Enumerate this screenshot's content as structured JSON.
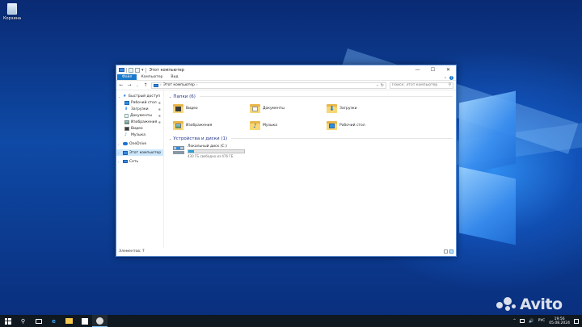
{
  "desktop": {
    "recycle_bin_label": "Корзина",
    "watermark": "Avito"
  },
  "window": {
    "title": "Этот компьютер",
    "quick_access_dropdown": "▾",
    "buttons": {
      "minimize": "—",
      "maximize": "☐",
      "close": "✕"
    },
    "ribbon_tabs": [
      "Файл",
      "Компьютер",
      "Вид"
    ],
    "ribbon_expand": "⌄",
    "help": "?",
    "address": {
      "path": "Этот компьютер",
      "separator": "›",
      "dropdown": "⌄",
      "refresh": "↻"
    },
    "search": {
      "placeholder": "Поиск: Этот компьютер",
      "icon": "⚲"
    },
    "nav": {
      "quick_access": "Быстрый доступ",
      "quick_items": [
        "Рабочий стол",
        "Загрузки",
        "Документы",
        "Изображения",
        "Видео",
        "Музыка"
      ],
      "pin": "✱",
      "onedrive": "OneDrive",
      "this_pc": "Этот компьютер",
      "network": "Сеть"
    },
    "folders_header": "Папки (6)",
    "folders": [
      "Видео",
      "Документы",
      "Загрузки",
      "Изображения",
      "Музыка",
      "Рабочий стол"
    ],
    "devices_header": "Устройства и диски (1)",
    "drive": {
      "name": "Локальный диск (C:)",
      "free_text": "430 ГБ свободно из 476 ГБ",
      "used_fraction": 0.0966
    },
    "status": "Элементов: 7"
  },
  "taskbar": {
    "search_icon": "⚲",
    "edge_icon": "e",
    "lang": "РУС",
    "time": "19:56",
    "date": "05.08.2024",
    "tray_arrow": "^",
    "volume": "🔊"
  },
  "colors": {
    "accent": "#1979ca",
    "selection": "#cce8ff",
    "drive_bar": "#26a0da",
    "group_header": "#1e3287"
  }
}
